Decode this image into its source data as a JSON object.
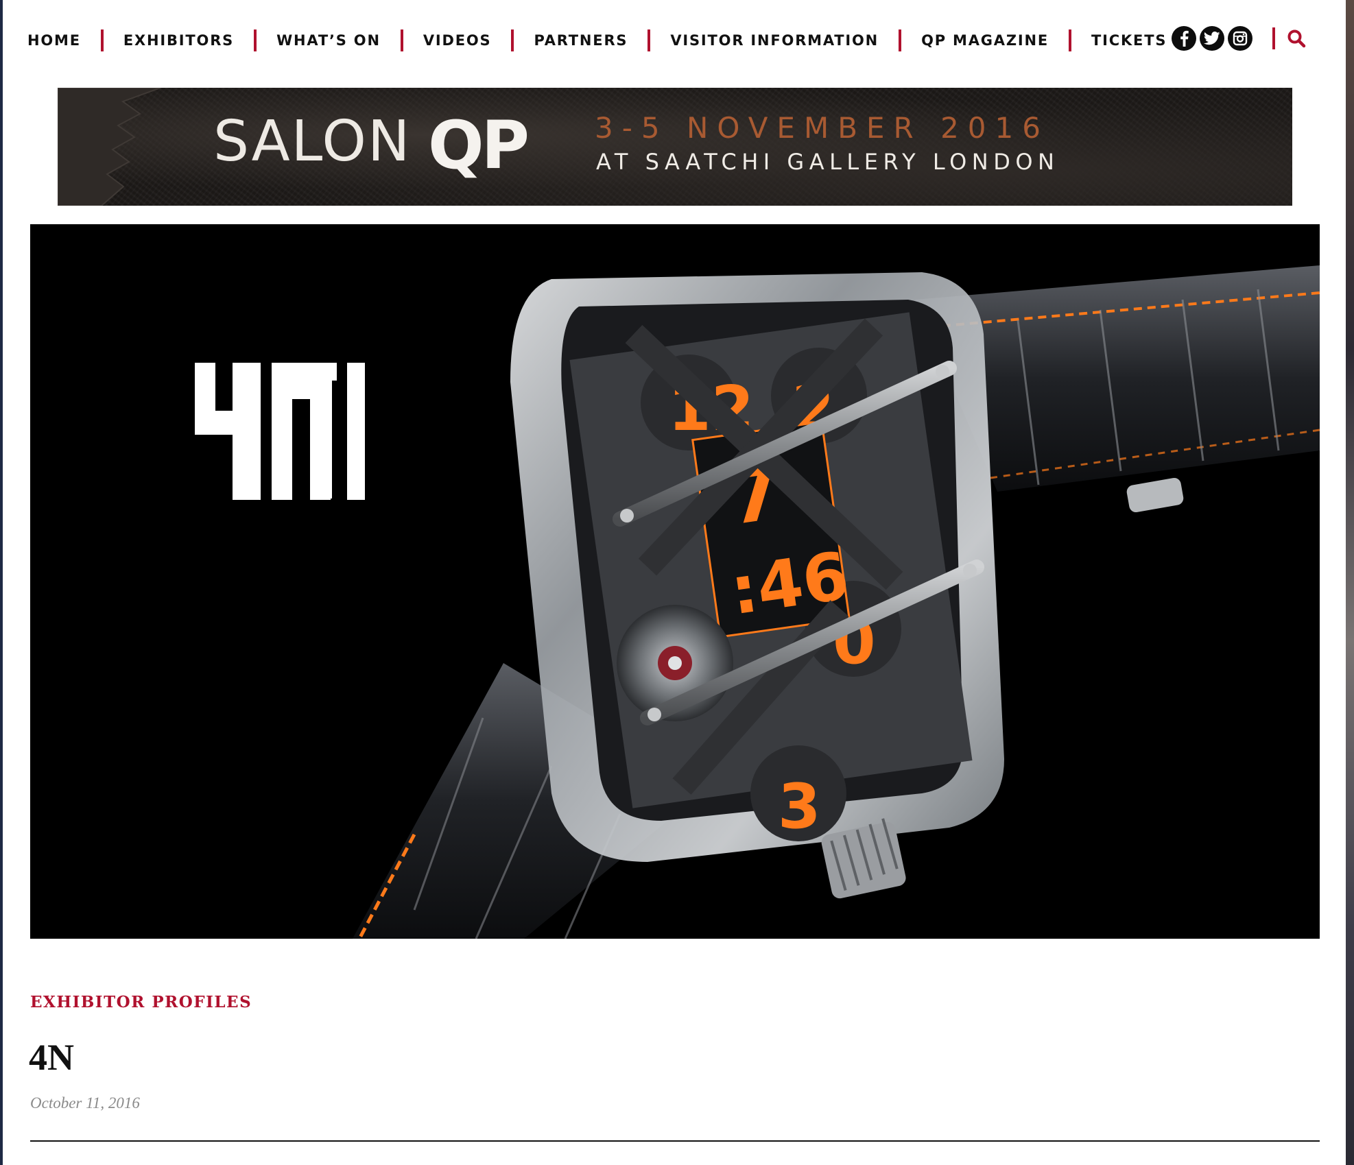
{
  "nav": {
    "items": [
      {
        "label": "HOME"
      },
      {
        "label": "EXHIBITORS"
      },
      {
        "label": "WHAT’S ON"
      },
      {
        "label": "VIDEOS"
      },
      {
        "label": "PARTNERS"
      },
      {
        "label": "VISITOR INFORMATION"
      },
      {
        "label": "QP MAGAZINE"
      },
      {
        "label": "TICKETS"
      }
    ],
    "social": [
      "facebook-icon",
      "twitter-icon",
      "instagram-icon"
    ],
    "search_icon": "search-icon",
    "separator_color": "#b0112e"
  },
  "banner": {
    "salon": "SALON",
    "qp": "QP",
    "date": "3-5 NOVEMBER 2016",
    "venue": "AT SAATCHI GALLERY LONDON",
    "date_color": "#a85a32"
  },
  "hero": {
    "logo_icon": "4n-logo-icon",
    "watch_icon": "watch-image"
  },
  "article": {
    "category": "EXHIBITOR PROFILES",
    "title": "4N",
    "date": "October 11, 2016",
    "accent_color": "#b0112e"
  }
}
